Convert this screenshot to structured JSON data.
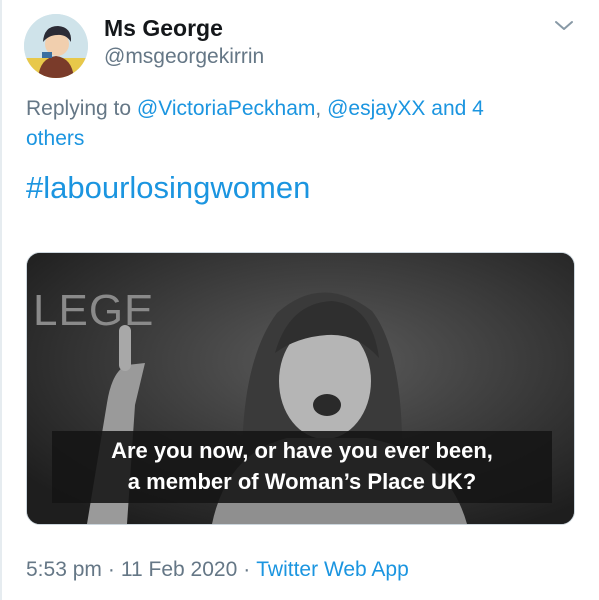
{
  "tweet": {
    "author": {
      "display_name": "Ms George",
      "handle": "@msgeorgekirrin"
    },
    "reply": {
      "prefix": "Replying to ",
      "mention_1": "@VictoriaPeckham",
      "comma": ", ",
      "mention_2": "@esjayXX",
      "suffix_and": " and ",
      "others": "4 others"
    },
    "text": "#labourlosingwomen",
    "media": {
      "background_sign": "LEGE",
      "caption_line_1": "Are you now, or have you ever been,",
      "caption_line_2": "a member of Woman’s Place UK?"
    },
    "meta": {
      "time": "5:53 pm",
      "date": "11 Feb 2020",
      "separator": "·",
      "source": "Twitter Web App"
    },
    "icons": {
      "menu": "chevron-down-icon"
    }
  }
}
